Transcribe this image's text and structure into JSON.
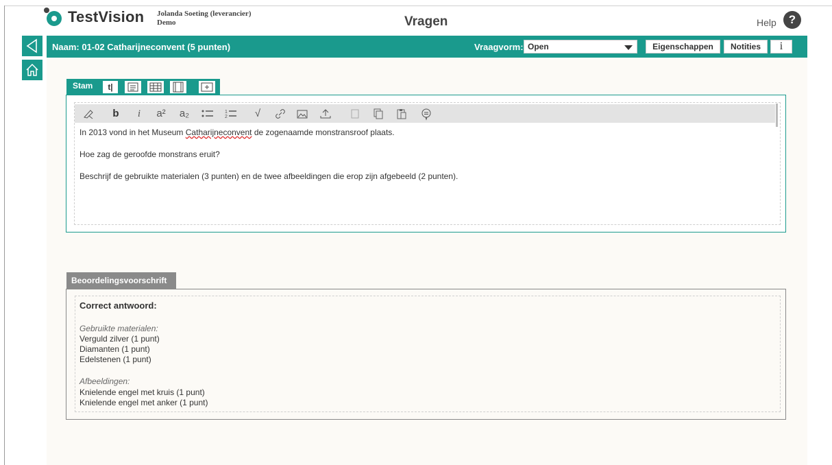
{
  "header": {
    "logo_text": "TestVision",
    "user_name": "Jolanda Soeting (leverancier)",
    "user_org": "Demo",
    "page_title": "Vragen",
    "help_label": "Help",
    "help_icon": "?"
  },
  "question": {
    "name": "Naam: 01-02 Catharijneconvent (5 punten)",
    "vraagvorm_label": "Vraagvorm:",
    "vraagvorm_value": "Open",
    "btn_eigenschappen": "Eigenschappen",
    "btn_notities": "Notities",
    "btn_info": "i"
  },
  "stam": {
    "tab_label": "Stam",
    "tab_text_icon": "t|",
    "para1_pre": "In 2013 vond in het Museum ",
    "para1_link": "Catharijneconvent",
    "para1_post": " de zogenaamde monstransroof plaats.",
    "para2": "Hoe zag de geroofde monstrans eruit?",
    "para3": "Beschrijf de gebruikte materialen (3 punten) en de twee afbeeldingen die erop zijn afgebeeld (2 punten)."
  },
  "toolbar": {
    "bold": "b",
    "italic": "i",
    "superscript": "a²",
    "subscript": "a₂",
    "sqrt": "√"
  },
  "beoordeling": {
    "tab_label": "Beoordelingsvoorschrift",
    "heading": "Correct antwoord:",
    "section1_title": "Gebruikte materialen:",
    "section1_items": [
      "Verguld zilver (1 punt)",
      "Diamanten (1 punt)",
      "Edelstenen (1 punt)"
    ],
    "section2_title": "Afbeeldingen:",
    "section2_items": [
      "Knielende engel met kruis (1 punt)",
      "Knielende engel met anker (1 punt)"
    ]
  },
  "colors": {
    "accent": "#1a9a8d",
    "tab_gray": "#8a8a8a",
    "content_bg": "#fcfaf6"
  }
}
